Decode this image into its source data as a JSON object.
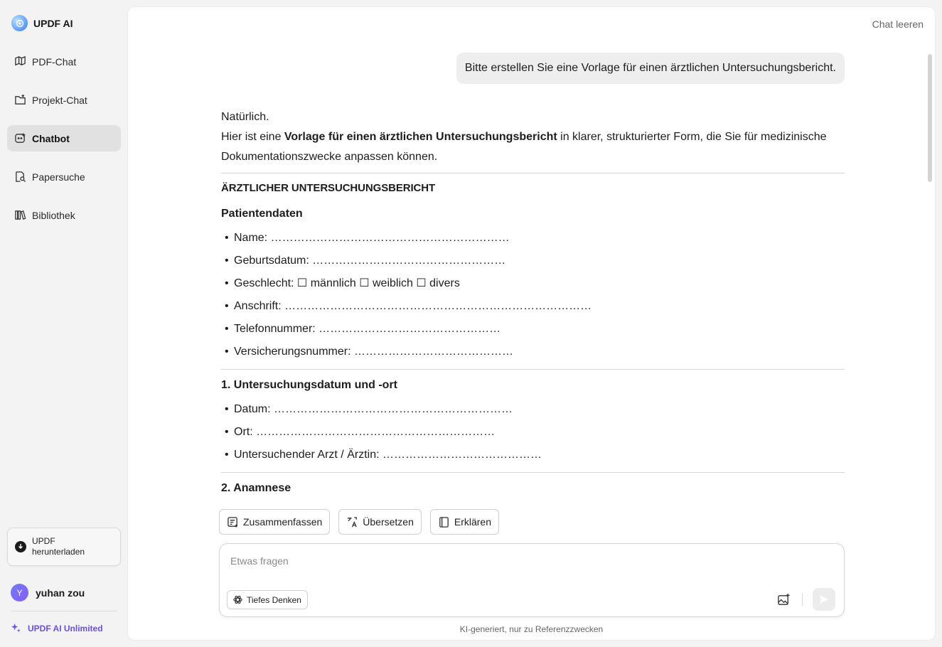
{
  "brand": {
    "name": "UPDF AI"
  },
  "sidebar": {
    "items": [
      {
        "label": "PDF-Chat",
        "icon": "book-open-icon",
        "active": false
      },
      {
        "label": "Projekt-Chat",
        "icon": "folder-plus-icon",
        "active": false
      },
      {
        "label": "Chatbot",
        "icon": "chatbot-icon",
        "active": true
      },
      {
        "label": "Papersuche",
        "icon": "paper-search-icon",
        "active": false
      },
      {
        "label": "Bibliothek",
        "icon": "library-icon",
        "active": false
      }
    ],
    "download_line1": "UPDF",
    "download_line2": "herunterladen",
    "user_initial": "Y",
    "user_name": "yuhan zou",
    "plan": "UPDF AI Unlimited"
  },
  "header": {
    "clear_chat": "Chat leeren"
  },
  "chat": {
    "user_message": "Bitte erstellen Sie eine Vorlage für einen ärztlichen Untersuchungsbericht.",
    "answer": {
      "intro_1": "Natürlich.",
      "intro_2_pre": "Hier ist eine ",
      "intro_2_bold": "Vorlage für einen ärztlichen Untersuchungsbericht",
      "intro_2_post": " in klarer, strukturierter Form, die Sie für medizinische",
      "intro_3": "Dokumentationszwecke anpassen können.",
      "doc_title": "ÄRZTLICHER UNTERSUCHUNGSBERICHT",
      "patient_heading": "Patientendaten",
      "patient_fields": [
        "Name: ………………………………………………………",
        "Geburtsdatum: ……………………………………………",
        "Geschlecht: ☐ männlich ☐ weiblich ☐ divers",
        "Anschrift: ………………………………………………………………………",
        "Telefonnummer: …………………………………………",
        "Versicherungsnummer: ……………………………………"
      ],
      "section1_heading": "1. Untersuchungsdatum und -ort",
      "section1_fields": [
        "Datum: ………………………………………………………",
        "Ort: ………………………………………………………",
        "Untersuchender Arzt / Ärztin: ……………………………………"
      ],
      "section2_heading": "2. Anamnese"
    }
  },
  "actions": {
    "summarize": "Zusammenfassen",
    "translate": "Übersetzen",
    "explain": "Erklären"
  },
  "composer": {
    "placeholder": "Etwas fragen",
    "deep_think": "Tiefes Denken"
  },
  "footer": {
    "disclaimer": "KI-generiert, nur zu Referenzzwecken"
  },
  "colors": {
    "accent": "#6b4ef0",
    "active_nav": "#e1e1e1",
    "bubble": "#eeeeee"
  }
}
